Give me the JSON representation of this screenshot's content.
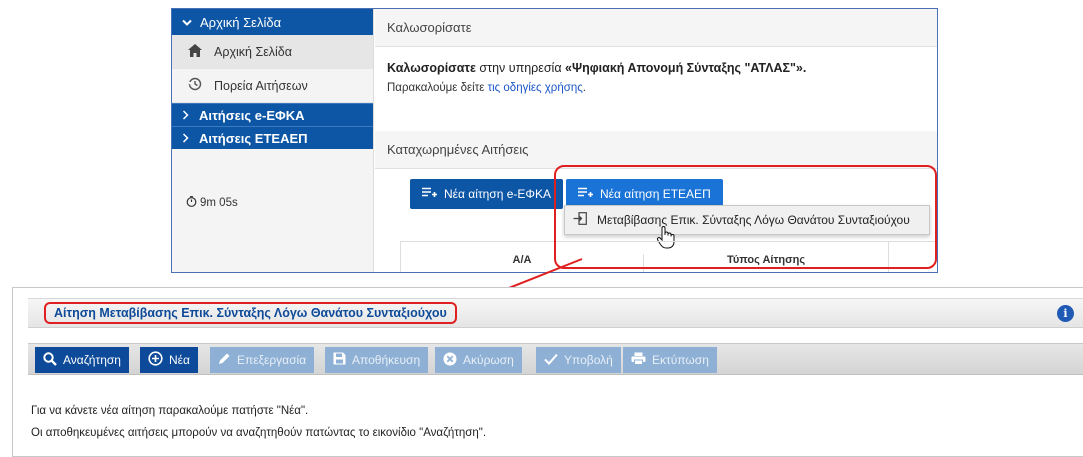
{
  "top_window": {
    "sidebar": {
      "header": "Αρχική Σελίδα",
      "items": [
        {
          "label": "Αρχική Σελίδα",
          "icon": "home-icon"
        },
        {
          "label": "Πορεία Αιτήσεων",
          "icon": "history-icon"
        }
      ],
      "groups": [
        {
          "label": "Αιτήσεις e-ΕΦΚΑ"
        },
        {
          "label": "Αιτήσεις ΕΤΕΑΕΠ"
        }
      ],
      "timer": "9m 05s"
    },
    "welcome_panel": {
      "header": "Καλωσορίσατε",
      "line1_bold": "Καλωσορίσατε",
      "line1_rest": " στην υπηρεσία ",
      "line1_service": "«Ψηφιακή Απονομή Σύνταξης \"ΑΤΛΑΣ\"».",
      "line2_prefix": "Παρακαλούμε δείτε ",
      "line2_link": "τις οδηγίες χρήσης",
      "line2_suffix": "."
    },
    "applications_panel": {
      "header": "Καταχωρημένες Αιτήσεις",
      "btn_efka": "Νέα αίτηση e-ΕΦΚΑ",
      "btn_eteaep": "Νέα αίτηση ΕΤΕΑΕΠ",
      "dropdown_item": "Μεταβίβασης Επικ. Σύνταξης Λόγω Θανάτου Συνταξιούχου",
      "columns": [
        "Α/Α",
        "Τύπος Αίτησης"
      ]
    }
  },
  "bottom_window": {
    "title": "Αίτηση Μεταβίβασης Επικ. Σύνταξης Λόγω Θανάτου Συνταξιούχου",
    "info": "i",
    "toolbar": [
      {
        "label": "Αναζήτηση",
        "icon": "search-icon",
        "enabled": true
      },
      {
        "label": "Νέα",
        "icon": "plus-circle-icon",
        "enabled": true
      },
      {
        "label": "Επεξεργασία",
        "icon": "pencil-icon",
        "enabled": false
      },
      {
        "label": "Αποθήκευση",
        "icon": "save-icon",
        "enabled": false
      },
      {
        "label": "Ακύρωση",
        "icon": "cancel-icon",
        "enabled": false
      },
      {
        "label": "Υποβολή",
        "icon": "check-icon",
        "enabled": false
      },
      {
        "label": "Εκτύπωση",
        "icon": "printer-icon",
        "enabled": false
      }
    ],
    "message1": "Για να κάνετε νέα αίτηση παρακαλούμε πατήστε \"Νέα\".",
    "message2": "Οι αποθηκευμένες αιτήσεις μπορούν να αναζητηθούν πατώντας το εικονίδιο \"Αναζήτηση\"."
  },
  "colors": {
    "brand_blue": "#0d56a6",
    "highlight_red": "#e02020",
    "disabled_blue": "#8eb0d4"
  }
}
